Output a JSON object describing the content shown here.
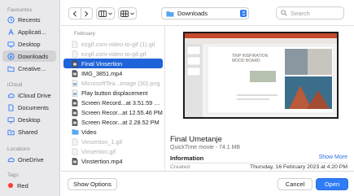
{
  "sidebar": {
    "favourites_label": "Favourites",
    "icloud_label": "iCloud",
    "locations_label": "Locations",
    "tags_label": "Tags",
    "items": [
      {
        "label": "Recents",
        "icon": "clock-icon"
      },
      {
        "label": "Applicati...",
        "icon": "applications-icon"
      },
      {
        "label": "Desktop",
        "icon": "desktop-icon"
      },
      {
        "label": "Downloads",
        "icon": "downloads-icon",
        "selected": true
      },
      {
        "label": "Creative...",
        "icon": "folder-icon"
      }
    ],
    "icloud_items": [
      {
        "label": "iCloud Drive",
        "icon": "cloud-icon"
      },
      {
        "label": "Documents",
        "icon": "document-icon"
      },
      {
        "label": "Desktop",
        "icon": "desktop-icon"
      },
      {
        "label": "Shared",
        "icon": "shared-folder-icon"
      }
    ],
    "location_items": [
      {
        "label": "OneDrive",
        "icon": "cloud-icon"
      }
    ],
    "tag_items": [
      {
        "label": "Red",
        "color": "#ff3b30"
      }
    ]
  },
  "toolbar": {
    "location": "Downloads",
    "search_placeholder": "Search"
  },
  "file_list": {
    "month": "February",
    "files": [
      {
        "name": "ezgif.com-video-to-gif (1).gif",
        "dim": true,
        "icon": "gif-file-icon"
      },
      {
        "name": "ezgif.com-video-to-gif.gif",
        "dim": true,
        "icon": "gif-file-icon"
      },
      {
        "name": "Final Vinsertion",
        "selected": true,
        "icon": "video-file-icon"
      },
      {
        "name": "IMG_3851.mp4",
        "icon": "video-file-icon"
      },
      {
        "name": "MicrosoftTea...image (30).png",
        "dim": true,
        "icon": "image-file-icon"
      },
      {
        "name": "Play button displacement",
        "icon": "image-file-icon"
      },
      {
        "name": "Screen Record...at 3.51.59 PM",
        "icon": "video-file-icon"
      },
      {
        "name": "Screen Recor...at 12.55.46 PM",
        "icon": "video-file-icon"
      },
      {
        "name": "Screen Recor...at 2.28.52 PM",
        "icon": "video-file-icon"
      },
      {
        "name": "Video",
        "icon": "folder-icon"
      },
      {
        "name": "Vinsertion_1.gif",
        "dim": true,
        "icon": "gif-file-icon"
      },
      {
        "name": "Vinsertion.gif",
        "dim": true,
        "icon": "gif-file-icon"
      },
      {
        "name": "Vinstertion.mp4",
        "icon": "video-file-icon"
      }
    ]
  },
  "preview": {
    "slide_heading": "TRIP INSPIRATION\nMOOD BOARD",
    "title": "Final Umetanje",
    "subtitle": "QuickTime movie - 74.1 MB",
    "info_label": "Information",
    "show_more": "Show More",
    "created_label": "Created",
    "created_value": "Thursday, 16 February 2023 at 4:20 PM"
  },
  "buttons": {
    "show_options": "Show Options",
    "cancel": "Cancel",
    "open": "Open"
  },
  "colors": {
    "accent": "#2f7cf6",
    "selection": "#1f63d8",
    "tag_red": "#ff3b30"
  }
}
